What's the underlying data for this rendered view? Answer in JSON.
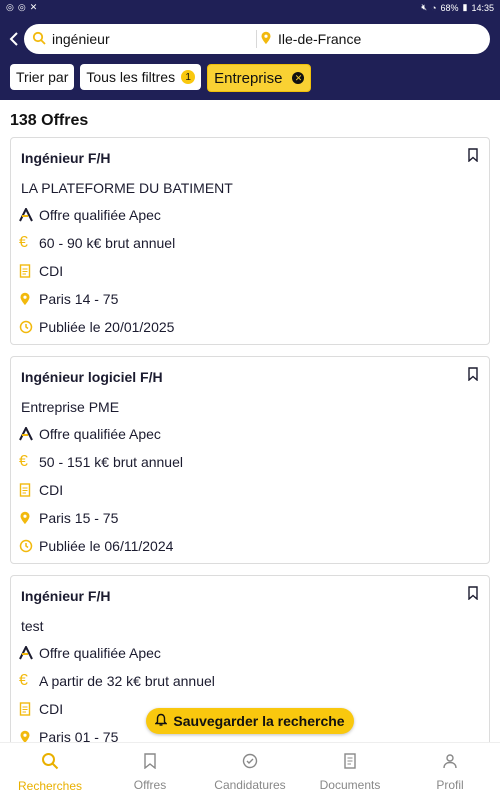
{
  "status": {
    "battery": "68%",
    "time": "14:35"
  },
  "search": {
    "query": "ingénieur",
    "location": "Ile-de-France"
  },
  "filters": {
    "sort_label": "Trier par",
    "all_filters_label": "Tous les filtres",
    "all_filters_count": "1",
    "active_chip": "Entreprise"
  },
  "results": {
    "count_label": "138 Offres"
  },
  "offers": [
    {
      "title": "Ingénieur F/H",
      "company": "LA PLATEFORME DU BATIMENT",
      "qualified": "Offre qualifiée Apec",
      "salary": "60 - 90 k€ brut annuel",
      "contract": "CDI",
      "location": "Paris 14 - 75",
      "published": "Publiée le 20/01/2025"
    },
    {
      "title": "Ingénieur logiciel F/H",
      "company": "Entreprise PME",
      "qualified": "Offre qualifiée Apec",
      "salary": "50 - 151 k€ brut annuel",
      "contract": "CDI",
      "location": "Paris 15 - 75",
      "published": "Publiée le 06/11/2024"
    },
    {
      "title": "Ingénieur F/H",
      "company": "test",
      "qualified": "Offre qualifiée Apec",
      "salary": "A partir de 32 k€ brut annuel",
      "contract": "CDI",
      "location": "Paris 01 - 75",
      "published": ""
    }
  ],
  "save_search_label": "Sauvegarder la recherche",
  "nav": {
    "recherches": "Recherches",
    "offres": "Offres",
    "candidatures": "Candidatures",
    "documents": "Documents",
    "profil": "Profil"
  },
  "colors": {
    "header": "#1f2056",
    "accent": "#f9c80e"
  }
}
